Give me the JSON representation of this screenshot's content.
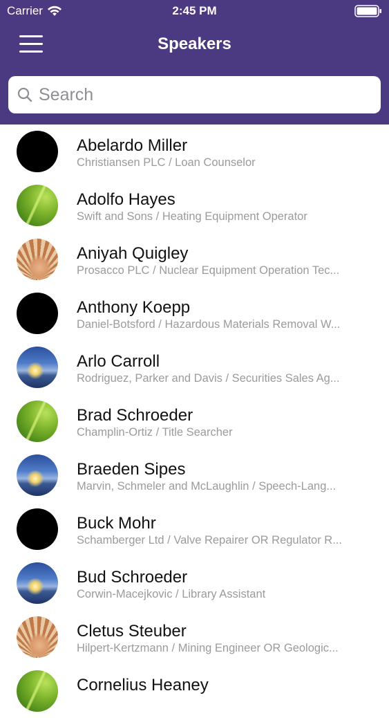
{
  "status_bar": {
    "carrier": "Carrier",
    "time": "2:45 PM"
  },
  "nav": {
    "title": "Speakers"
  },
  "search": {
    "placeholder": "Search"
  },
  "colors": {
    "header_bg": "#4b3a82",
    "list_bg": "#ffffff",
    "name_text": "#111111",
    "subtitle_text": "#9b9b9b"
  },
  "speakers": [
    {
      "name": "Abelardo Miller",
      "subtitle": "Christiansen PLC / Loan Counselor",
      "avatar": "black"
    },
    {
      "name": "Adolfo Hayes",
      "subtitle": "Swift and Sons / Heating Equipment Operator",
      "avatar": "leaf"
    },
    {
      "name": "Aniyah Quigley",
      "subtitle": "Prosacco PLC / Nuclear Equipment Operation Tec...",
      "avatar": "fan"
    },
    {
      "name": "Anthony Koepp",
      "subtitle": "Daniel-Botsford / Hazardous Materials Removal W...",
      "avatar": "black"
    },
    {
      "name": "Arlo Carroll",
      "subtitle": "Rodriguez, Parker and Davis / Securities Sales Ag...",
      "avatar": "beach"
    },
    {
      "name": "Brad Schroeder",
      "subtitle": "Champlin-Ortiz / Title Searcher",
      "avatar": "leaf"
    },
    {
      "name": "Braeden Sipes",
      "subtitle": "Marvin, Schmeler and McLaughlin / Speech-Lang...",
      "avatar": "beach"
    },
    {
      "name": "Buck Mohr",
      "subtitle": "Schamberger Ltd / Valve Repairer OR Regulator R...",
      "avatar": "black"
    },
    {
      "name": "Bud Schroeder",
      "subtitle": "Corwin-Macejkovic / Library Assistant",
      "avatar": "beach"
    },
    {
      "name": "Cletus Steuber",
      "subtitle": "Hilpert-Kertzmann / Mining Engineer OR Geologic...",
      "avatar": "fan"
    },
    {
      "name": "Cornelius Heaney",
      "subtitle": "",
      "avatar": "leaf"
    }
  ]
}
